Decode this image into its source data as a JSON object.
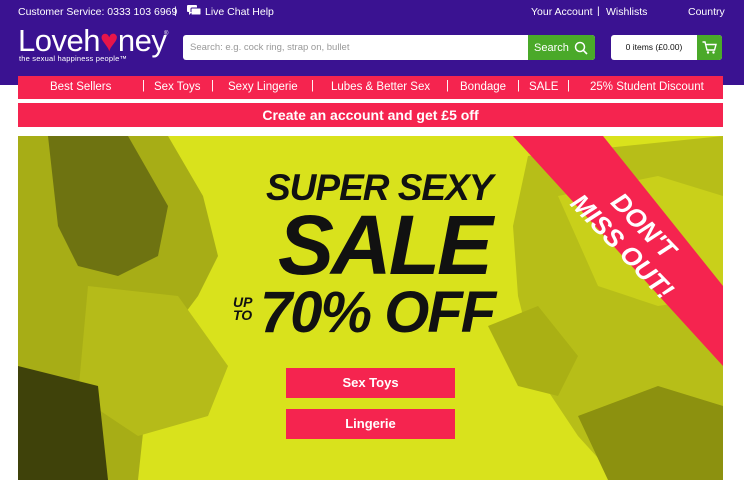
{
  "topbar": {
    "customer_service": "Customer Service: 0333 103 6969",
    "separator": "|",
    "live_chat": "Live Chat Help",
    "your_account": "Your Account",
    "wishlists": "Wishlists",
    "country": "Country"
  },
  "logo": {
    "word_start": "Loveh",
    "heart": "♥",
    "word_end": "ney",
    "registered": "®",
    "tagline": "the sexual happiness people™"
  },
  "search": {
    "placeholder": "Search: e.g. cock ring, strap on, bullet",
    "button_label": "Search",
    "icon": "search-icon"
  },
  "cart": {
    "label": "0 items (£0.00)",
    "icon": "cart-icon"
  },
  "nav": {
    "items": [
      "Best Sellers",
      "Sex Toys",
      "Sexy Lingerie",
      "Lubes & Better Sex",
      "Bondage",
      "SALE",
      "25% Student Discount"
    ],
    "separator": "|"
  },
  "promo": {
    "text": "Create an account and get £5 off"
  },
  "hero": {
    "line1": "SUPER SEXY",
    "line2": "SALE",
    "up": "UP",
    "to": "TO",
    "line3": "70% OFF",
    "ribbon_line1": "DON'T",
    "ribbon_line2": "MISS OUT!",
    "cta_sex_toys": "Sex Toys",
    "cta_lingerie": "Lingerie"
  },
  "colors": {
    "header_purple": "#3a1291",
    "brand_pink": "#f5244f",
    "search_green": "#4aa929",
    "hero_yellow": "#d9e21c"
  }
}
